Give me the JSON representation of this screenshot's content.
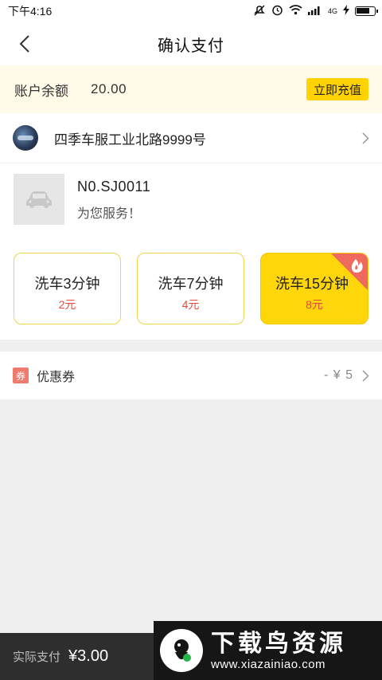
{
  "status_bar": {
    "time": "下午4:16",
    "network": "4G",
    "icons": [
      "mute-icon",
      "alarm-icon",
      "wifi-icon",
      "signal-icon",
      "charging-icon",
      "battery-icon"
    ]
  },
  "header": {
    "title": "确认支付",
    "back_icon": "chevron-left-icon"
  },
  "balance": {
    "label": "账户余额",
    "value": "20.00",
    "recharge_label": "立即充值",
    "accent_color": "#ffd200"
  },
  "store": {
    "name": "四季车服工业北路9999号"
  },
  "staff": {
    "id": "N0.SJ0011",
    "greeting": "为您服务！"
  },
  "wash_options": [
    {
      "name": "洗车3分钟",
      "price": "2元",
      "selected": false
    },
    {
      "name": "洗车7分钟",
      "price": "4元",
      "selected": false
    },
    {
      "name": "洗车15分钟",
      "price": "8元",
      "selected": true,
      "hot": true
    }
  ],
  "coupon": {
    "badge": "券",
    "label": "优惠券",
    "value": "- ¥ 5"
  },
  "footer": {
    "pay_label": "实际支付",
    "pay_amount": "¥3.00"
  },
  "watermark": {
    "title": "下载鸟资源",
    "url": "www.xiazainiao.com"
  }
}
